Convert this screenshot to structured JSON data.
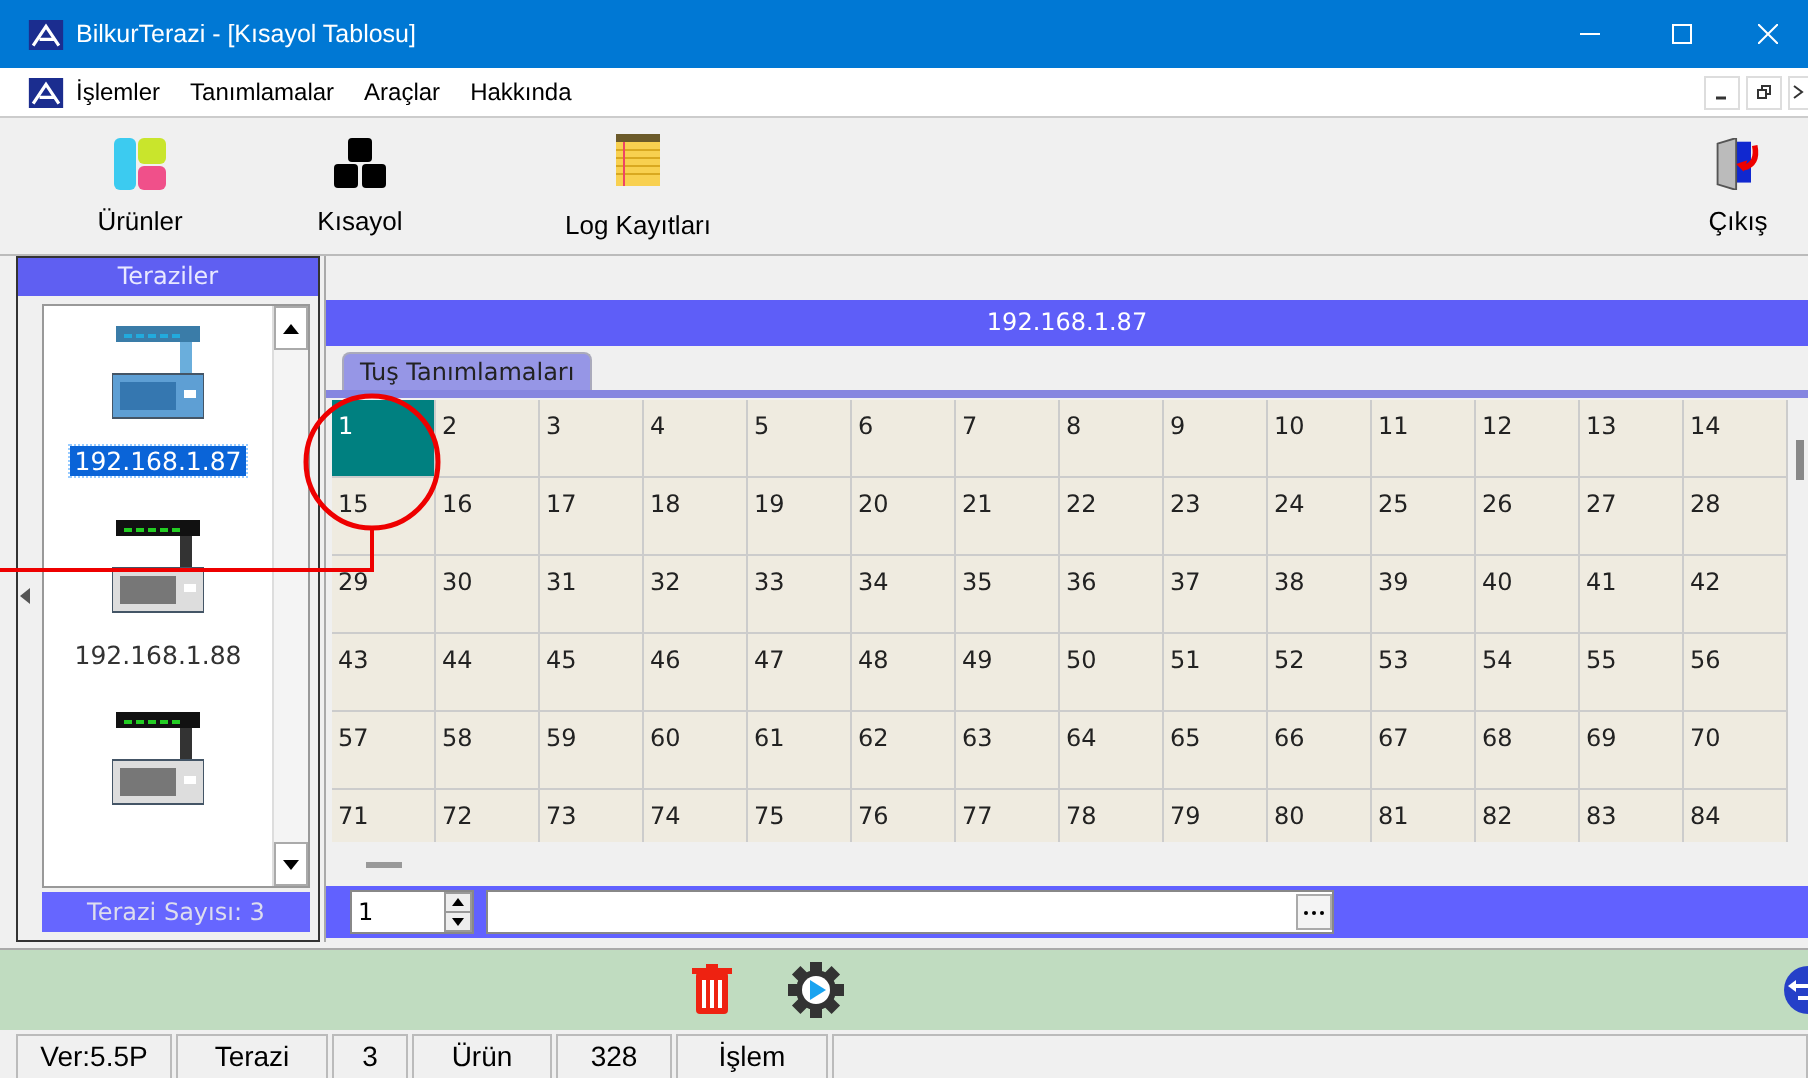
{
  "window": {
    "title": "BilkurTerazi  - [Kısayol Tablosu]"
  },
  "menu": [
    "İşlemler",
    "Tanımlamalar",
    "Araçlar",
    "Hakkında"
  ],
  "toolbar": [
    {
      "kind": "products",
      "label": "Ürünler"
    },
    {
      "kind": "shortcut",
      "label": "Kısayol"
    },
    {
      "kind": "log",
      "label": "Log Kayıtları"
    },
    {
      "kind": "exit",
      "label": "Çıkış"
    }
  ],
  "scales_panel": {
    "title": "Teraziler",
    "items": [
      {
        "label": "192.168.1.87",
        "selected": true
      },
      {
        "label": "192.168.1.88",
        "selected": false
      },
      {
        "selected": false
      }
    ],
    "footer": "Terazi Sayısı: 3"
  },
  "header": "192.168.1.87",
  "tabs": [
    {
      "label": "Tuş Tanımlamaları",
      "selected": true
    }
  ],
  "keys": [
    {
      "label": "1",
      "selected": true
    },
    {
      "label": "2",
      "selected": false
    },
    {
      "label": "3",
      "selected": false
    },
    {
      "label": "4",
      "selected": false
    },
    {
      "label": "5",
      "selected": false
    },
    {
      "label": "6",
      "selected": false
    },
    {
      "label": "7",
      "selected": false
    },
    {
      "label": "8",
      "selected": false
    },
    {
      "label": "9",
      "selected": false
    },
    {
      "label": "10",
      "selected": false
    },
    {
      "label": "11",
      "selected": false
    },
    {
      "label": "12",
      "selected": false
    },
    {
      "label": "13",
      "selected": false
    },
    {
      "label": "14",
      "selected": false
    },
    {
      "label": "15",
      "selected": false
    },
    {
      "label": "16",
      "selected": false
    },
    {
      "label": "17",
      "selected": false
    },
    {
      "label": "18",
      "selected": false
    },
    {
      "label": "19",
      "selected": false
    },
    {
      "label": "20",
      "selected": false
    },
    {
      "label": "21",
      "selected": false
    },
    {
      "label": "22",
      "selected": false
    },
    {
      "label": "23",
      "selected": false
    },
    {
      "label": "24",
      "selected": false
    },
    {
      "label": "25",
      "selected": false
    },
    {
      "label": "26",
      "selected": false
    },
    {
      "label": "27",
      "selected": false
    },
    {
      "label": "28",
      "selected": false
    },
    {
      "label": "29",
      "selected": false
    },
    {
      "label": "30",
      "selected": false
    },
    {
      "label": "31",
      "selected": false
    },
    {
      "label": "32",
      "selected": false
    },
    {
      "label": "33",
      "selected": false
    },
    {
      "label": "34",
      "selected": false
    },
    {
      "label": "35",
      "selected": false
    },
    {
      "label": "36",
      "selected": false
    },
    {
      "label": "37",
      "selected": false
    },
    {
      "label": "38",
      "selected": false
    },
    {
      "label": "39",
      "selected": false
    },
    {
      "label": "40",
      "selected": false
    },
    {
      "label": "41",
      "selected": false
    },
    {
      "label": "42",
      "selected": false
    },
    {
      "label": "43",
      "selected": false
    },
    {
      "label": "44",
      "selected": false
    },
    {
      "label": "45",
      "selected": false
    },
    {
      "label": "46",
      "selected": false
    },
    {
      "label": "47",
      "selected": false
    },
    {
      "label": "48",
      "selected": false
    },
    {
      "label": "49",
      "selected": false
    },
    {
      "label": "50",
      "selected": false
    },
    {
      "label": "51",
      "selected": false
    },
    {
      "label": "52",
      "selected": false
    },
    {
      "label": "53",
      "selected": false
    },
    {
      "label": "54",
      "selected": false
    },
    {
      "label": "55",
      "selected": false
    },
    {
      "label": "56",
      "selected": false
    },
    {
      "label": "57",
      "selected": false
    },
    {
      "label": "58",
      "selected": false
    },
    {
      "label": "59",
      "selected": false
    },
    {
      "label": "60",
      "selected": false
    },
    {
      "label": "61",
      "selected": false
    },
    {
      "label": "62",
      "selected": false
    },
    {
      "label": "63",
      "selected": false
    },
    {
      "label": "64",
      "selected": false
    },
    {
      "label": "65",
      "selected": false
    },
    {
      "label": "66",
      "selected": false
    },
    {
      "label": "67",
      "selected": false
    },
    {
      "label": "68",
      "selected": false
    },
    {
      "label": "69",
      "selected": false
    },
    {
      "label": "70",
      "selected": false
    },
    {
      "label": "71",
      "selected": false
    },
    {
      "label": "72",
      "selected": false
    },
    {
      "label": "73",
      "selected": false
    },
    {
      "label": "74",
      "selected": false
    },
    {
      "label": "75",
      "selected": false
    },
    {
      "label": "76",
      "selected": false
    },
    {
      "label": "77",
      "selected": false
    },
    {
      "label": "78",
      "selected": false
    },
    {
      "label": "79",
      "selected": false
    },
    {
      "label": "80",
      "selected": false
    },
    {
      "label": "81",
      "selected": false
    },
    {
      "label": "82",
      "selected": false
    },
    {
      "label": "83",
      "selected": false
    },
    {
      "label": "84",
      "selected": false
    }
  ],
  "key_number": "1",
  "status_bar": [
    "Ver:5.5P",
    "Terazi",
    "3",
    "Ürün",
    "328",
    "İşlem"
  ]
}
